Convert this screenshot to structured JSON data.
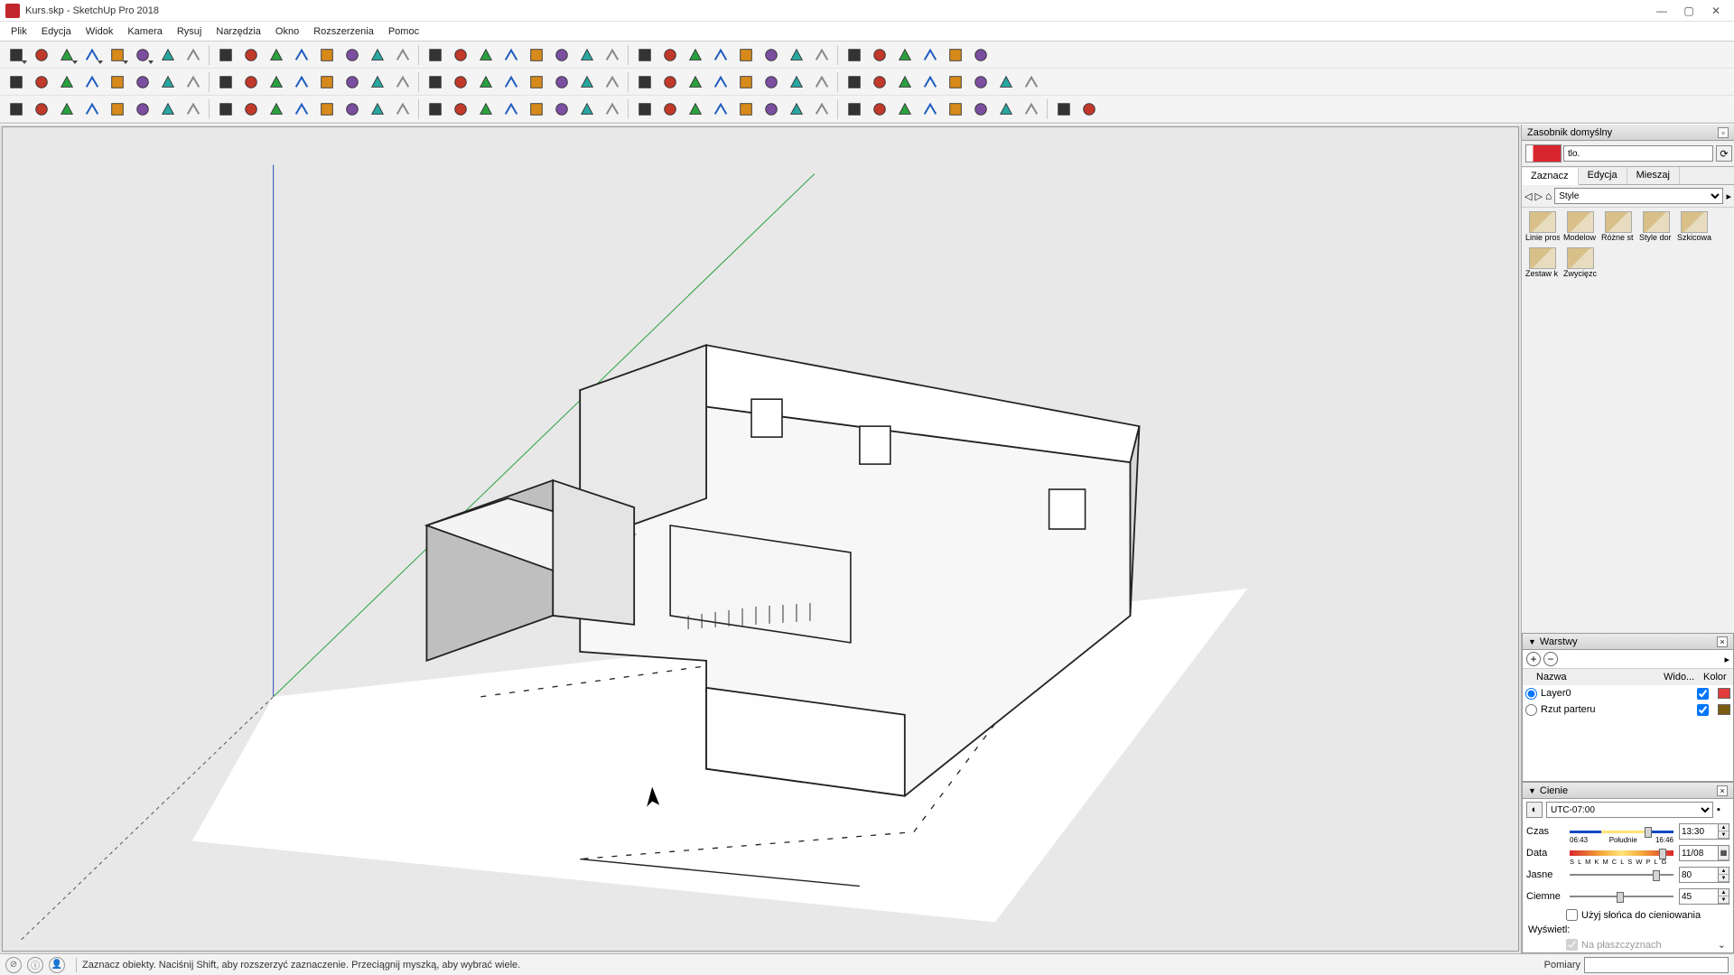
{
  "window": {
    "title": "Kurs.skp - SketchUp Pro 2018"
  },
  "menu": [
    "Plik",
    "Edycja",
    "Widok",
    "Kamera",
    "Rysuj",
    "Narzędzia",
    "Okno",
    "Rozszerzenia",
    "Pomoc"
  ],
  "status": {
    "hint": "Zaznacz obiekty. Naciśnij Shift, aby rozszerzyć zaznaczenie. Przeciągnij myszką, aby wybrać wiele.",
    "measure_label": "Pomiary"
  },
  "tray": {
    "title": "Zasobnik domyślny",
    "search": "tlo.",
    "tabs": [
      "Zaznacz",
      "Edycja",
      "Mieszaj"
    ],
    "style_combo": "Style",
    "styles": [
      "Linie pros",
      "Modelow",
      "Różne st",
      "Style dor",
      "Szkicowa",
      "Zestaw k",
      "Zwycięzc"
    ]
  },
  "layers": {
    "title": "Warstwy",
    "cols": {
      "name": "Nazwa",
      "vis": "Wido...",
      "color": "Kolor"
    },
    "rows": [
      {
        "name": "Layer0",
        "active": true,
        "visible": true,
        "color": "#e23c3c"
      },
      {
        "name": "Rzut parteru",
        "active": false,
        "visible": true,
        "color": "#7a5a10"
      }
    ]
  },
  "shadows": {
    "title": "Cienie",
    "tz": "UTC-07:00",
    "time_label": "Czas",
    "time": "13:30",
    "time_lo": "06:43",
    "time_mid": "Południe",
    "time_hi": "16:46",
    "date_label": "Data",
    "date": "11/08",
    "months": "S L M K M C L S W P L G",
    "light_label": "Jasne",
    "light": "80",
    "dark_label": "Ciemne",
    "dark": "45",
    "use_sun": "Użyj słońca do cieniowania",
    "display_label": "Wyświetl:",
    "on_faces": "Na płaszczyznach"
  }
}
